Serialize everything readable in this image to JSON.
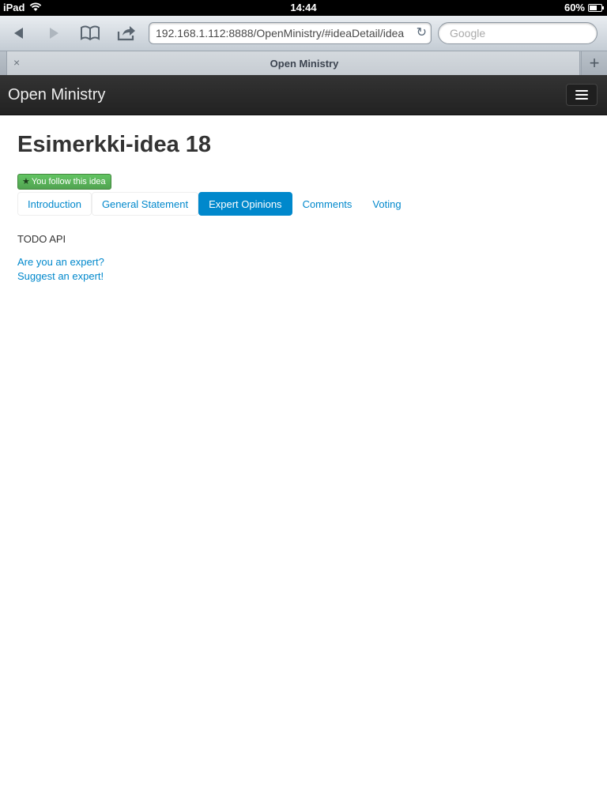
{
  "status_bar": {
    "device": "iPad",
    "time": "14:44",
    "battery": "60%"
  },
  "browser": {
    "url": "192.168.1.112:8888/OpenMinistry/#ideaDetail/idea",
    "search_placeholder": "Google",
    "tab_title": "Open Ministry",
    "tab_close": "×",
    "new_tab": "+"
  },
  "app": {
    "brand": "Open Ministry"
  },
  "idea": {
    "title": "Esimerkki-idea 18",
    "follow_label": "You follow this idea",
    "tabs": [
      {
        "label": "Introduction"
      },
      {
        "label": "General Statement"
      },
      {
        "label": "Expert Opinions"
      },
      {
        "label": "Comments"
      },
      {
        "label": "Voting"
      }
    ],
    "active_tab": "Expert Opinions",
    "todo_text": "TODO API",
    "links": [
      {
        "label": "Are you an expert?"
      },
      {
        "label": "Suggest an expert!"
      }
    ]
  },
  "colors": {
    "accent": "#0088cc",
    "follow_green": "#51a351",
    "navbar": "#222222"
  }
}
